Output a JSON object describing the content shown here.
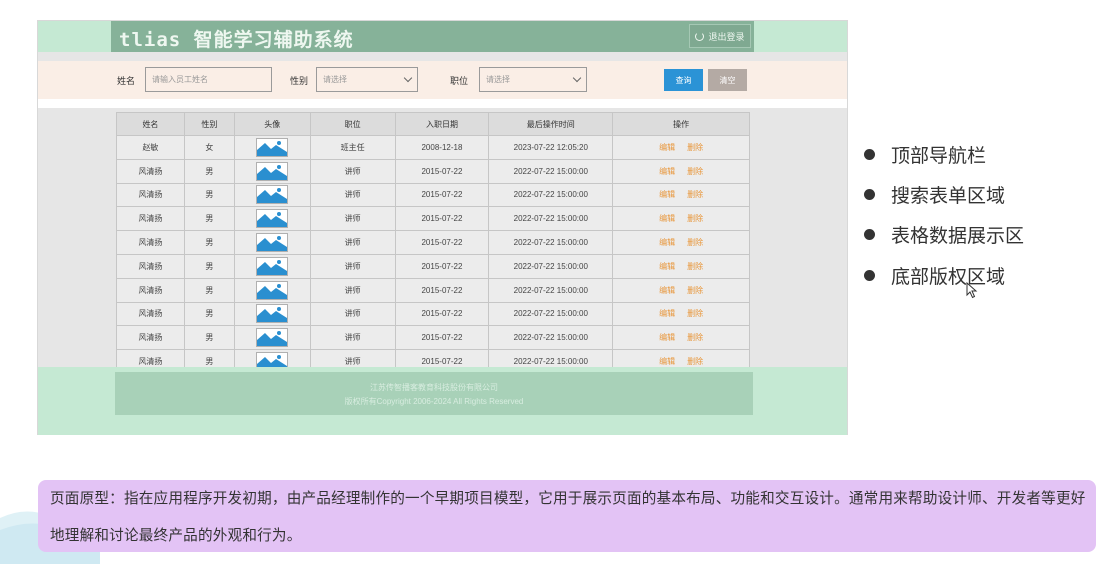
{
  "app": {
    "title": "tlias 智能学习辅助系统",
    "logout_label": "退出登录"
  },
  "search": {
    "name_label": "姓名",
    "name_placeholder": "请输入员工姓名",
    "gender_label": "性别",
    "gender_value": "请选择",
    "job_label": "职位",
    "job_value": "请选择",
    "query_label": "查询",
    "clear_label": "清空"
  },
  "table": {
    "headers": [
      "姓名",
      "性别",
      "头像",
      "职位",
      "入职日期",
      "最后操作时间",
      "操作"
    ],
    "edit_label": "编辑",
    "delete_label": "删除",
    "rows": [
      {
        "name": "赵敏",
        "gender": "女",
        "job": "班主任",
        "entry": "2008-12-18",
        "updated": "2023-07-22 12:05:20"
      },
      {
        "name": "风清扬",
        "gender": "男",
        "job": "讲师",
        "entry": "2015-07-22",
        "updated": "2022-07-22 15:00:00"
      },
      {
        "name": "风清扬",
        "gender": "男",
        "job": "讲师",
        "entry": "2015-07-22",
        "updated": "2022-07-22 15:00:00"
      },
      {
        "name": "风清扬",
        "gender": "男",
        "job": "讲师",
        "entry": "2015-07-22",
        "updated": "2022-07-22 15:00:00"
      },
      {
        "name": "风清扬",
        "gender": "男",
        "job": "讲师",
        "entry": "2015-07-22",
        "updated": "2022-07-22 15:00:00"
      },
      {
        "name": "风清扬",
        "gender": "男",
        "job": "讲师",
        "entry": "2015-07-22",
        "updated": "2022-07-22 15:00:00"
      },
      {
        "name": "风清扬",
        "gender": "男",
        "job": "讲师",
        "entry": "2015-07-22",
        "updated": "2022-07-22 15:00:00"
      },
      {
        "name": "风清扬",
        "gender": "男",
        "job": "讲师",
        "entry": "2015-07-22",
        "updated": "2022-07-22 15:00:00"
      },
      {
        "name": "风清扬",
        "gender": "男",
        "job": "讲师",
        "entry": "2015-07-22",
        "updated": "2022-07-22 15:00:00"
      },
      {
        "name": "风清扬",
        "gender": "男",
        "job": "讲师",
        "entry": "2015-07-22",
        "updated": "2022-07-22 15:00:00"
      }
    ]
  },
  "footer": {
    "company": "江苏传智播客教育科技股份有限公司",
    "copyright": "版权所有Copyright 2006-2024 All Rights Reserved"
  },
  "bullets": [
    "顶部导航栏",
    "搜索表单区域",
    "表格数据展示区",
    "底部版权区域"
  ],
  "description": "页面原型：指在应用程序开发初期，由产品经理制作的一个早期项目模型，它用于展示页面的基本布局、功能和交互设计。通常用来帮助设计师、开发者等更好地理解和讨论最终产品的外观和行为。",
  "colors": {
    "nav_bg": "#86b299",
    "search_bg": "#faeee6",
    "query_button": "#2b93d6",
    "action_link": "#e8963a",
    "description_bg": "#e3c3f5"
  }
}
